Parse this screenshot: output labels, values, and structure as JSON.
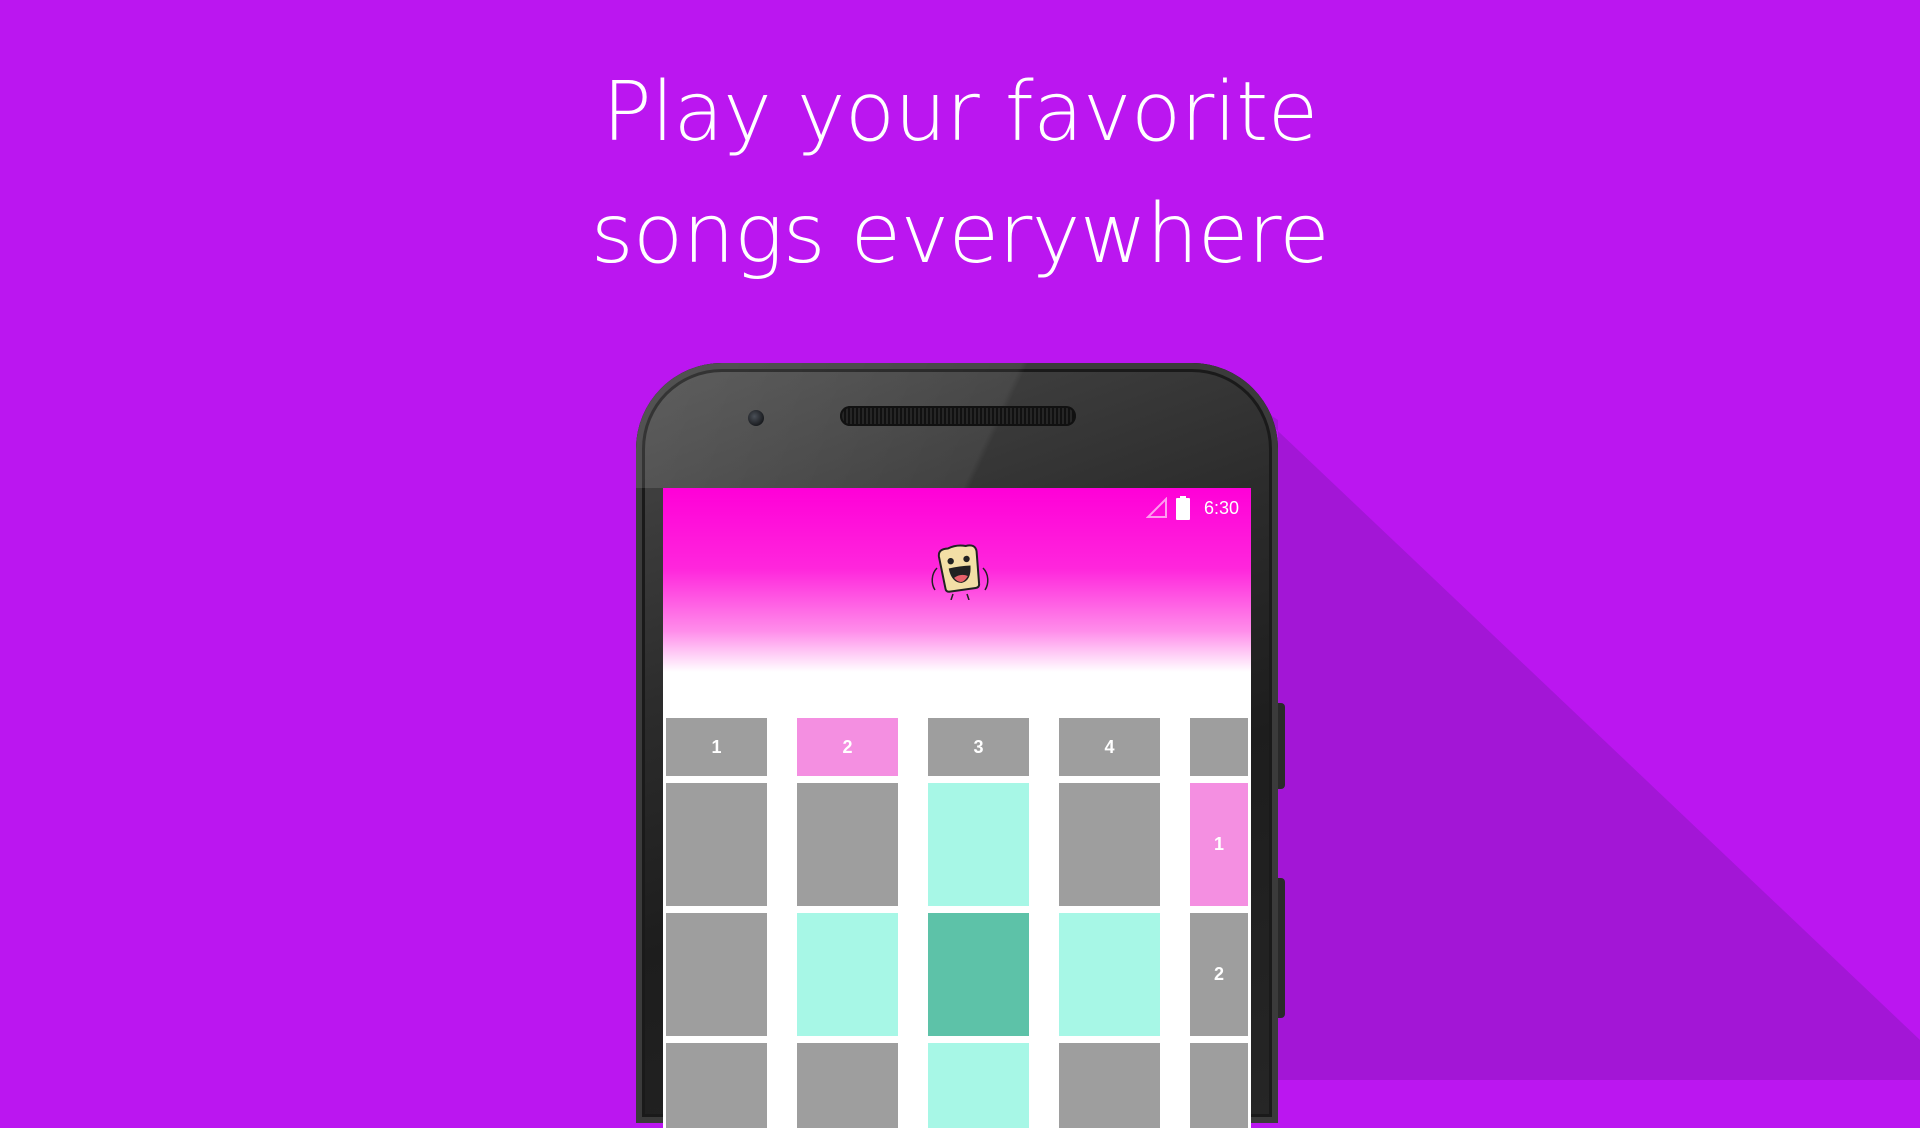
{
  "headline": {
    "line1": "Play your favorite",
    "line2": "songs everywhere"
  },
  "status_bar": {
    "time": "6:30",
    "icons": [
      "signal-icon",
      "battery-icon"
    ]
  },
  "mascot": {
    "icon": "toast-mascot-icon"
  },
  "colors": {
    "background": "#BB16F0",
    "header_pink": "#FF00D8",
    "cell_gray": "#9E9E9E",
    "cell_pink": "#F48FE1",
    "cell_mint": "#A7F7E6",
    "cell_teal": "#5DC2A8"
  },
  "grid": {
    "header_row": [
      {
        "label": "1",
        "color": "gray"
      },
      {
        "label": "2",
        "color": "pink"
      },
      {
        "label": "3",
        "color": "gray"
      },
      {
        "label": "4",
        "color": "gray"
      },
      {
        "label": "",
        "color": "gray"
      }
    ],
    "rows": [
      {
        "cells": [
          "gray",
          "gray",
          "mint",
          "gray"
        ],
        "side_label": "1",
        "side_color": "pink"
      },
      {
        "cells": [
          "gray",
          "mint",
          "teal",
          "mint"
        ],
        "side_label": "2",
        "side_color": "gray"
      },
      {
        "cells": [
          "gray",
          "gray",
          "mint",
          "gray"
        ],
        "side_label": "",
        "side_color": "gray"
      }
    ]
  }
}
